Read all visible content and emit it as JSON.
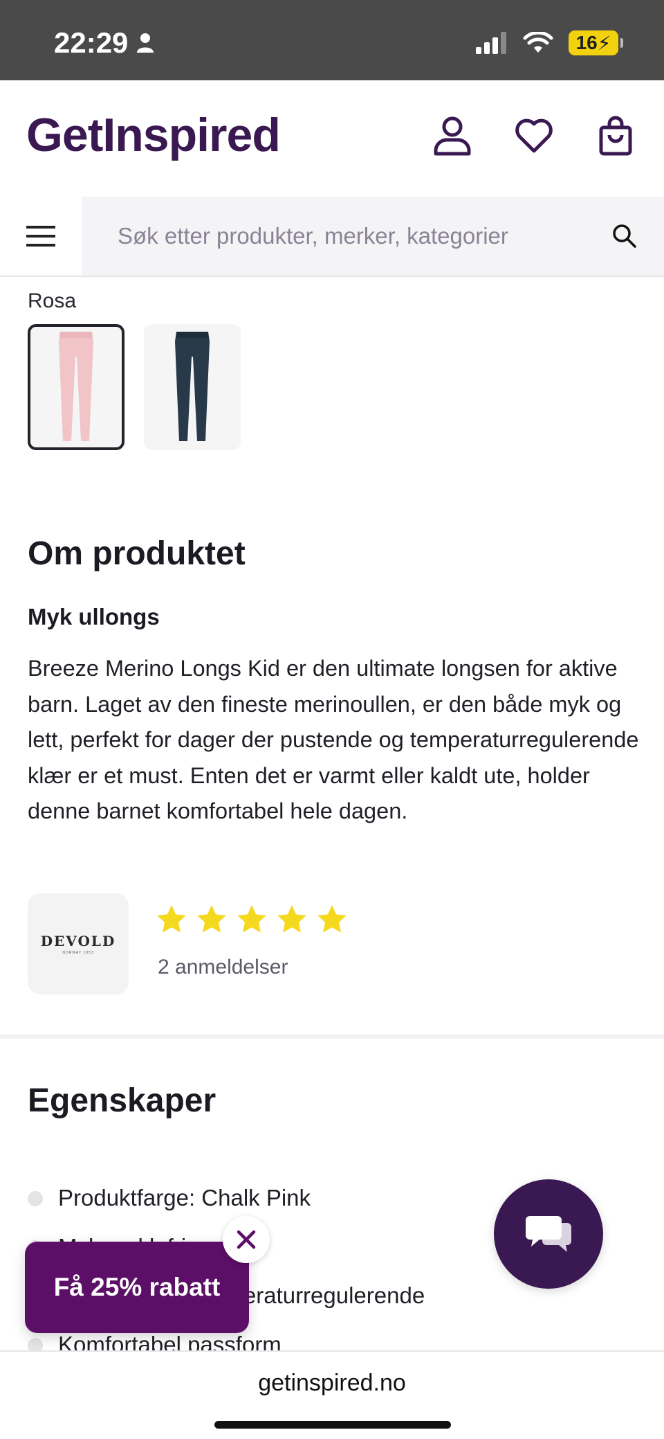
{
  "status_bar": {
    "time": "22:29",
    "battery": "16"
  },
  "header": {
    "logo": "GetInspired",
    "icons": [
      "account-icon",
      "heart-icon",
      "bag-icon"
    ]
  },
  "search": {
    "placeholder": "Søk etter produkter, merker, kategorier"
  },
  "variant": {
    "label": "Rosa",
    "swatches": [
      "Rosa",
      "Navy"
    ]
  },
  "about": {
    "title": "Om produktet",
    "subtitle": "Myk ullongs",
    "description": "Breeze Merino Longs Kid er den ultimate longsen for aktive barn. Laget av den fineste merinoullen, er den både myk og lett, perfekt for dager der pustende og temperaturregulerende klær er et must. Enten det er varmt eller kaldt ute, holder denne barnet komfortabel hele dagen."
  },
  "brand": {
    "name": "DEVOLD",
    "sub": "NORWAY 1853"
  },
  "rating": {
    "stars": 5,
    "max": 5,
    "reviews": "2 anmeldelser"
  },
  "properties": {
    "title": "Egenskaper",
    "items": [
      "Produktfarge: Chalk Pink",
      "Myk og klofri",
      "Pustende og temperaturregulerende",
      "Komfortabel passform"
    ]
  },
  "promo": {
    "label": "Få 25% rabatt"
  },
  "url_bar": {
    "url": "getinspired.no"
  },
  "colors": {
    "brand": "#3a1851",
    "promo": "#5c0f66",
    "star": "#f5d91f"
  }
}
